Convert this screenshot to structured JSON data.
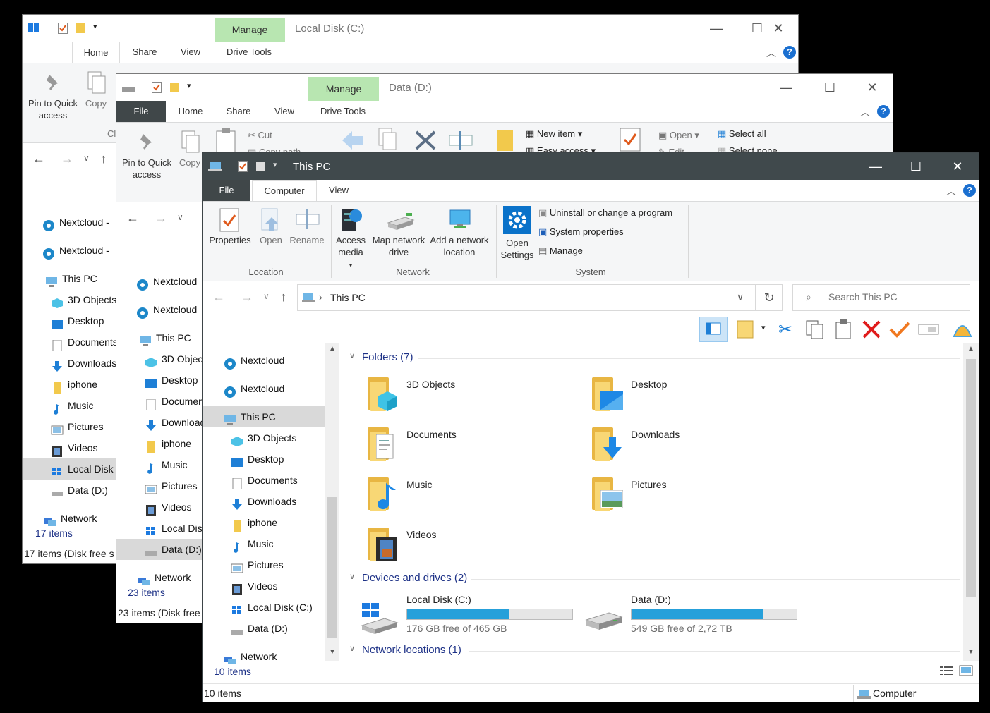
{
  "back1": {
    "title": "Local Disk (C:)",
    "manage": "Manage",
    "tabs": [
      "Home",
      "Share",
      "View",
      "Drive Tools"
    ],
    "ribbon": {
      "pin": "Pin to Quick access",
      "copy": "Copy",
      "cut": "Cut",
      "new_item": "New item",
      "open": "Open",
      "select_all": "Select all",
      "cl": "Cl"
    },
    "nav": [
      "Nextcloud -",
      "Nextcloud -",
      "This PC",
      "3D Objects",
      "Desktop",
      "Documents",
      "Downloads",
      "iphone",
      "Music",
      "Pictures",
      "Videos",
      "Local Disk",
      "Data (D:)",
      "Network"
    ],
    "items_count": "17 items",
    "status": "17 items (Disk free s"
  },
  "back2": {
    "title": "Data (D:)",
    "manage": "Manage",
    "tabs": [
      "File",
      "Home",
      "Share",
      "View",
      "Drive Tools"
    ],
    "ribbon": {
      "pin": "Pin to Quick access",
      "copy": "Copy",
      "cut": "Cut",
      "copy_path": "Copy path",
      "new_item": "New item",
      "easy_access": "Easy access",
      "open": "Open",
      "edit": "Edit",
      "select_all": "Select all",
      "select_none": "Select none"
    },
    "nav": [
      "Nextcloud",
      "Nextcloud",
      "This PC",
      "3D Objects",
      "Desktop",
      "Documents",
      "Downloads",
      "iphone",
      "Music",
      "Pictures",
      "Videos",
      "Local Disk",
      "Data (D:)",
      "Network"
    ],
    "items_count": "23 items",
    "status": "23 items (Disk free"
  },
  "front": {
    "title": "This PC",
    "tabs": [
      "File",
      "Computer",
      "View"
    ],
    "ribbon": {
      "location": {
        "label": "Location",
        "properties": "Properties",
        "open": "Open",
        "rename": "Rename"
      },
      "network": {
        "label": "Network",
        "access_media": "Access media",
        "map_drive": "Map network drive",
        "add_location": "Add a network location"
      },
      "system": {
        "label": "System",
        "open_settings": "Open Settings",
        "uninstall": "Uninstall or change a program",
        "system_properties": "System properties",
        "manage": "Manage"
      }
    },
    "address": {
      "path": "This PC",
      "search_placeholder": "Search This PC"
    },
    "nav": [
      "Nextcloud",
      "Nextcloud",
      "This PC",
      "3D Objects",
      "Desktop",
      "Documents",
      "Downloads",
      "iphone",
      "Music",
      "Pictures",
      "Videos",
      "Local Disk (C:)",
      "Data (D:)",
      "Network"
    ],
    "groups": {
      "folders": "Folders (7)",
      "devices": "Devices and drives (2)",
      "network": "Network locations (1)"
    },
    "folders": [
      "3D Objects",
      "Desktop",
      "Documents",
      "Downloads",
      "Music",
      "Pictures",
      "Videos"
    ],
    "drives": [
      {
        "name": "Local Disk (C:)",
        "free": "176 GB free of 465 GB",
        "used_fraction": 0.62
      },
      {
        "name": "Data (D:)",
        "free": "549 GB free of 2,72 TB",
        "used_fraction": 0.8
      }
    ],
    "items_count": "10 items",
    "status_left": "10 items",
    "status_right": "Computer"
  },
  "colors": {
    "accent": "#26a0da",
    "manage_tab": "#b8e6b1",
    "file_tab": "#404749",
    "title_dark": "#40494c"
  }
}
